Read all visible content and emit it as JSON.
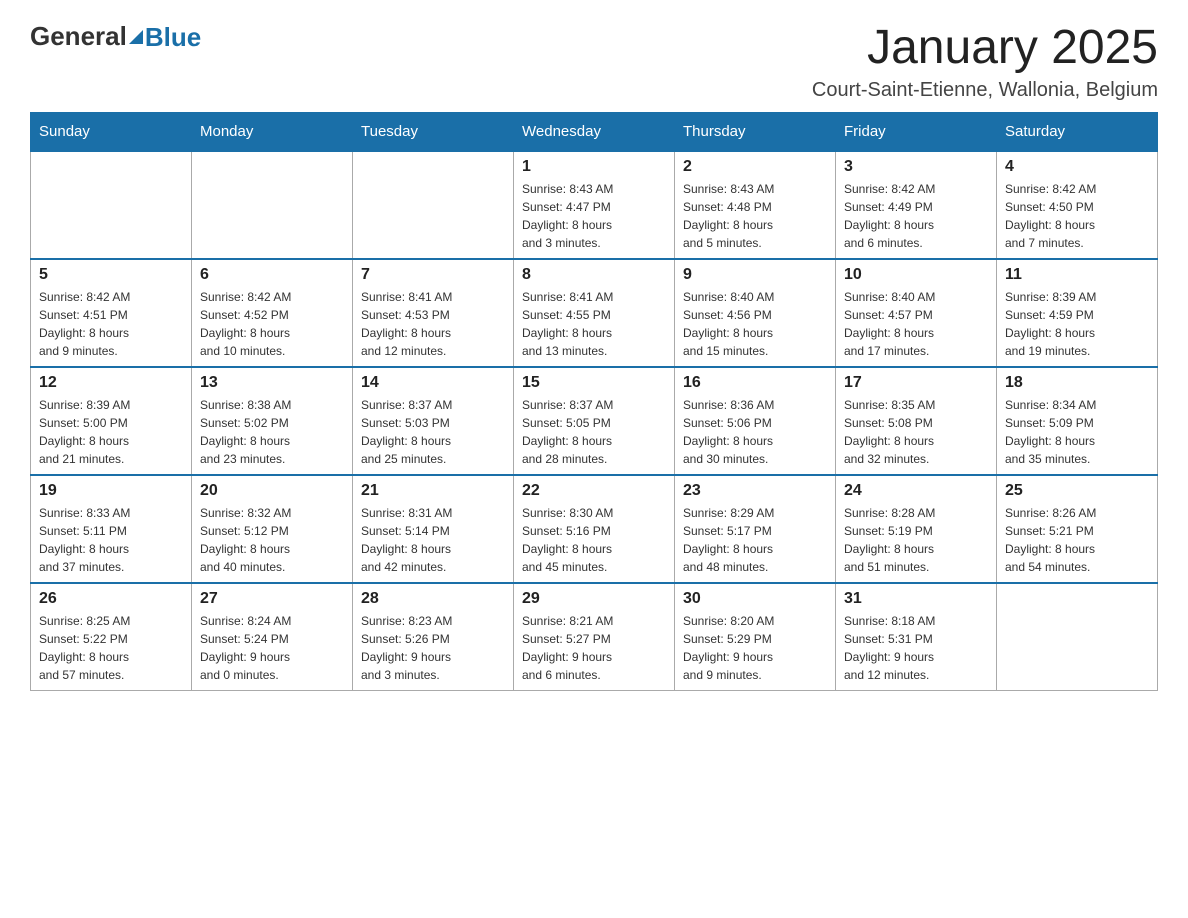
{
  "header": {
    "logo": {
      "general": "General",
      "blue": "Blue"
    },
    "title": "January 2025",
    "location": "Court-Saint-Etienne, Wallonia, Belgium"
  },
  "weekdays": [
    "Sunday",
    "Monday",
    "Tuesday",
    "Wednesday",
    "Thursday",
    "Friday",
    "Saturday"
  ],
  "weeks": [
    [
      {
        "day": "",
        "info": ""
      },
      {
        "day": "",
        "info": ""
      },
      {
        "day": "",
        "info": ""
      },
      {
        "day": "1",
        "info": "Sunrise: 8:43 AM\nSunset: 4:47 PM\nDaylight: 8 hours\nand 3 minutes."
      },
      {
        "day": "2",
        "info": "Sunrise: 8:43 AM\nSunset: 4:48 PM\nDaylight: 8 hours\nand 5 minutes."
      },
      {
        "day": "3",
        "info": "Sunrise: 8:42 AM\nSunset: 4:49 PM\nDaylight: 8 hours\nand 6 minutes."
      },
      {
        "day": "4",
        "info": "Sunrise: 8:42 AM\nSunset: 4:50 PM\nDaylight: 8 hours\nand 7 minutes."
      }
    ],
    [
      {
        "day": "5",
        "info": "Sunrise: 8:42 AM\nSunset: 4:51 PM\nDaylight: 8 hours\nand 9 minutes."
      },
      {
        "day": "6",
        "info": "Sunrise: 8:42 AM\nSunset: 4:52 PM\nDaylight: 8 hours\nand 10 minutes."
      },
      {
        "day": "7",
        "info": "Sunrise: 8:41 AM\nSunset: 4:53 PM\nDaylight: 8 hours\nand 12 minutes."
      },
      {
        "day": "8",
        "info": "Sunrise: 8:41 AM\nSunset: 4:55 PM\nDaylight: 8 hours\nand 13 minutes."
      },
      {
        "day": "9",
        "info": "Sunrise: 8:40 AM\nSunset: 4:56 PM\nDaylight: 8 hours\nand 15 minutes."
      },
      {
        "day": "10",
        "info": "Sunrise: 8:40 AM\nSunset: 4:57 PM\nDaylight: 8 hours\nand 17 minutes."
      },
      {
        "day": "11",
        "info": "Sunrise: 8:39 AM\nSunset: 4:59 PM\nDaylight: 8 hours\nand 19 minutes."
      }
    ],
    [
      {
        "day": "12",
        "info": "Sunrise: 8:39 AM\nSunset: 5:00 PM\nDaylight: 8 hours\nand 21 minutes."
      },
      {
        "day": "13",
        "info": "Sunrise: 8:38 AM\nSunset: 5:02 PM\nDaylight: 8 hours\nand 23 minutes."
      },
      {
        "day": "14",
        "info": "Sunrise: 8:37 AM\nSunset: 5:03 PM\nDaylight: 8 hours\nand 25 minutes."
      },
      {
        "day": "15",
        "info": "Sunrise: 8:37 AM\nSunset: 5:05 PM\nDaylight: 8 hours\nand 28 minutes."
      },
      {
        "day": "16",
        "info": "Sunrise: 8:36 AM\nSunset: 5:06 PM\nDaylight: 8 hours\nand 30 minutes."
      },
      {
        "day": "17",
        "info": "Sunrise: 8:35 AM\nSunset: 5:08 PM\nDaylight: 8 hours\nand 32 minutes."
      },
      {
        "day": "18",
        "info": "Sunrise: 8:34 AM\nSunset: 5:09 PM\nDaylight: 8 hours\nand 35 minutes."
      }
    ],
    [
      {
        "day": "19",
        "info": "Sunrise: 8:33 AM\nSunset: 5:11 PM\nDaylight: 8 hours\nand 37 minutes."
      },
      {
        "day": "20",
        "info": "Sunrise: 8:32 AM\nSunset: 5:12 PM\nDaylight: 8 hours\nand 40 minutes."
      },
      {
        "day": "21",
        "info": "Sunrise: 8:31 AM\nSunset: 5:14 PM\nDaylight: 8 hours\nand 42 minutes."
      },
      {
        "day": "22",
        "info": "Sunrise: 8:30 AM\nSunset: 5:16 PM\nDaylight: 8 hours\nand 45 minutes."
      },
      {
        "day": "23",
        "info": "Sunrise: 8:29 AM\nSunset: 5:17 PM\nDaylight: 8 hours\nand 48 minutes."
      },
      {
        "day": "24",
        "info": "Sunrise: 8:28 AM\nSunset: 5:19 PM\nDaylight: 8 hours\nand 51 minutes."
      },
      {
        "day": "25",
        "info": "Sunrise: 8:26 AM\nSunset: 5:21 PM\nDaylight: 8 hours\nand 54 minutes."
      }
    ],
    [
      {
        "day": "26",
        "info": "Sunrise: 8:25 AM\nSunset: 5:22 PM\nDaylight: 8 hours\nand 57 minutes."
      },
      {
        "day": "27",
        "info": "Sunrise: 8:24 AM\nSunset: 5:24 PM\nDaylight: 9 hours\nand 0 minutes."
      },
      {
        "day": "28",
        "info": "Sunrise: 8:23 AM\nSunset: 5:26 PM\nDaylight: 9 hours\nand 3 minutes."
      },
      {
        "day": "29",
        "info": "Sunrise: 8:21 AM\nSunset: 5:27 PM\nDaylight: 9 hours\nand 6 minutes."
      },
      {
        "day": "30",
        "info": "Sunrise: 8:20 AM\nSunset: 5:29 PM\nDaylight: 9 hours\nand 9 minutes."
      },
      {
        "day": "31",
        "info": "Sunrise: 8:18 AM\nSunset: 5:31 PM\nDaylight: 9 hours\nand 12 minutes."
      },
      {
        "day": "",
        "info": ""
      }
    ]
  ]
}
